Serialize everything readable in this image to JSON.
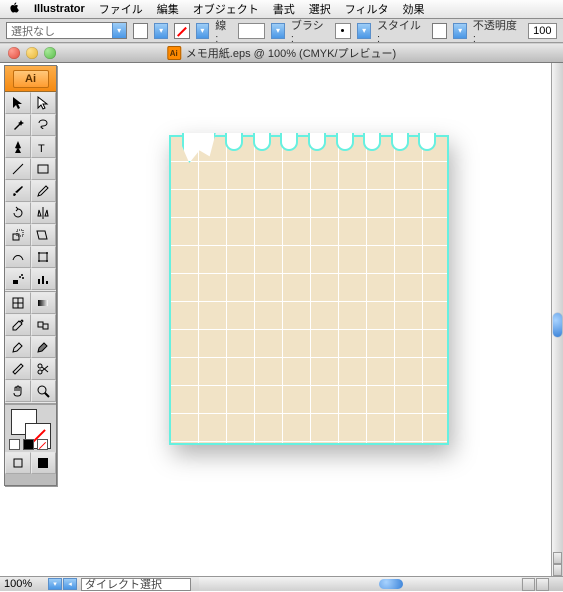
{
  "menubar": {
    "app": "Illustrator",
    "items": [
      "ファイル",
      "編集",
      "オブジェクト",
      "書式",
      "選択",
      "フィルタ",
      "効果"
    ]
  },
  "controlbar": {
    "selection": "選択なし",
    "stroke_label": "線 :",
    "stroke_weight": "",
    "brush_label": "ブラシ :",
    "style_label": "スタイル :",
    "opacity_label": "不透明度 :",
    "opacity_value": "100"
  },
  "window": {
    "title": "メモ用紙.eps @ 100% (CMYK/プレビュー)"
  },
  "tools": {
    "app_badge": "Ai"
  },
  "statusbar": {
    "zoom": "100%",
    "selection_tool": "ダイレクト選択"
  }
}
